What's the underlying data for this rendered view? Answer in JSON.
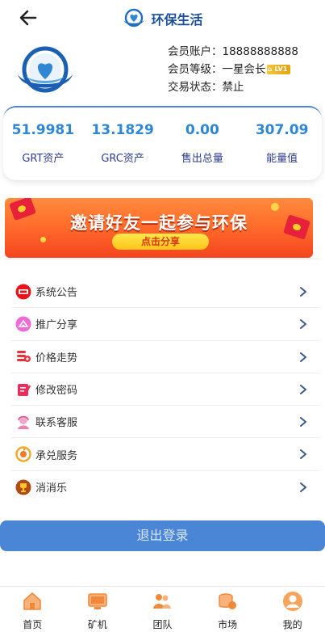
{
  "header": {
    "title": "环保生活"
  },
  "profile": {
    "account_label": "会员账户：",
    "account_value": "18888888888",
    "level_label": "会员等级：",
    "level_value": "一星会长",
    "level_badge": "LV1",
    "status_label": "交易状态：",
    "status_value": "禁止"
  },
  "stats": [
    {
      "value": "51.9981",
      "label": "GRT资产"
    },
    {
      "value": "13.1829",
      "label": "GRC资产"
    },
    {
      "value": "0.00",
      "label": "售出总量"
    },
    {
      "value": "307.09",
      "label": "能量值"
    }
  ],
  "banner": {
    "title": "邀请好友一起参与环保",
    "button": "点击分享"
  },
  "menu": [
    {
      "label": "系统公告",
      "icon": "notice-icon"
    },
    {
      "label": "推广分享",
      "icon": "share-icon"
    },
    {
      "label": "价格走势",
      "icon": "price-trend-icon"
    },
    {
      "label": "修改密码",
      "icon": "edit-password-icon"
    },
    {
      "label": "联系客服",
      "icon": "customer-service-icon"
    },
    {
      "label": "承兑服务",
      "icon": "exchange-icon"
    },
    {
      "label": "消消乐",
      "icon": "trophy-icon"
    }
  ],
  "logout": {
    "label": "退出登录"
  },
  "tabs": [
    {
      "label": "首页",
      "icon": "home-icon"
    },
    {
      "label": "矿机",
      "icon": "miner-icon"
    },
    {
      "label": "团队",
      "icon": "team-icon"
    },
    {
      "label": "市场",
      "icon": "market-icon"
    },
    {
      "label": "我的",
      "icon": "profile-icon"
    }
  ],
  "colors": {
    "accent": "#4b86d6",
    "stat_value": "#2e86d4",
    "stat_label": "#2f3d8f",
    "title": "#1a4f9c",
    "tab_icon": "#f59a3a"
  }
}
